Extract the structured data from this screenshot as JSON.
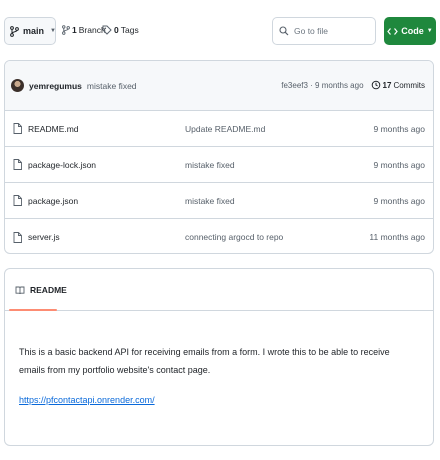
{
  "toolbar": {
    "branch_label": "main",
    "branch_count": "1",
    "branch_word": "Branch",
    "tag_count": "0",
    "tag_word": "Tags",
    "goto_placeholder": "Go to file",
    "code_label": "Code"
  },
  "commit": {
    "author": "yemregumus",
    "message": "mistake fixed",
    "hash_time": "fe3eef3 · 9 months ago",
    "commits_count": "17",
    "commits_word": "Commits"
  },
  "files": [
    {
      "name": "README.md",
      "message": "Update README.md",
      "date": "9 months ago"
    },
    {
      "name": "package-lock.json",
      "message": "mistake fixed",
      "date": "9 months ago"
    },
    {
      "name": "package.json",
      "message": "mistake fixed",
      "date": "9 months ago"
    },
    {
      "name": "server.js",
      "message": "connecting argocd to repo",
      "date": "11 months ago"
    }
  ],
  "readme": {
    "tab_label": "README",
    "description": "This is a basic backend API for receiving emails from a form. I wrote this to be able to receive emails from my portfolio website's contact page.",
    "link": "https://pfcontactapi.onrender.com/"
  },
  "colors": {
    "accent_green": "#1f883d",
    "link_blue": "#0969da",
    "tab_underline": "#fd8c73",
    "border": "#d0d7de"
  },
  "icons": [
    "branch-icon",
    "tag-icon",
    "search-icon",
    "code-icon",
    "history-icon",
    "file-icon",
    "book-icon"
  ]
}
